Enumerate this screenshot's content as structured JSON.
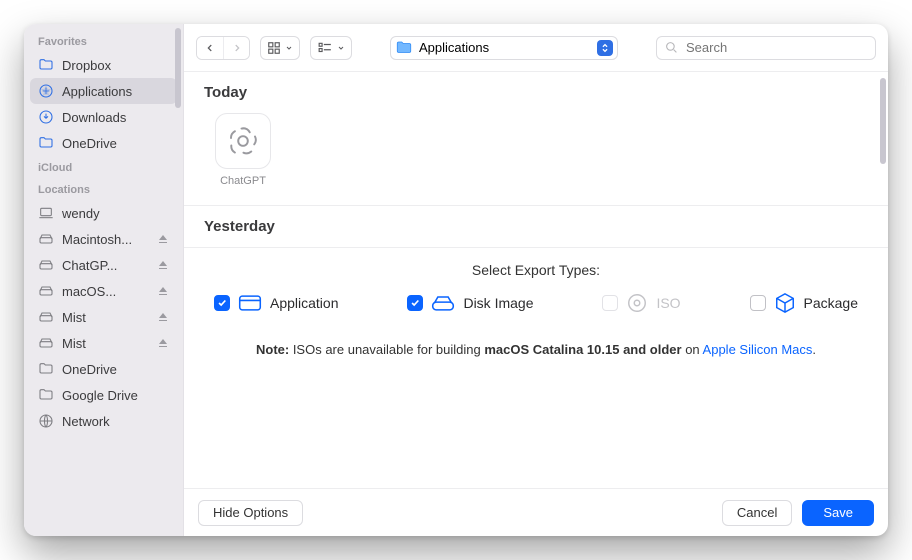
{
  "sidebar": {
    "sections": [
      {
        "label": "Favorites",
        "items": [
          {
            "label": "Dropbox",
            "icon": "folder"
          },
          {
            "label": "Applications",
            "icon": "apps",
            "active": true
          },
          {
            "label": "Downloads",
            "icon": "download"
          },
          {
            "label": "OneDrive",
            "icon": "folder"
          }
        ]
      },
      {
        "label": "iCloud",
        "items": []
      },
      {
        "label": "Locations",
        "items": [
          {
            "label": "wendy",
            "icon": "laptop"
          },
          {
            "label": "Macintosh...",
            "icon": "disk",
            "eject": true
          },
          {
            "label": "ChatGP...",
            "icon": "disk",
            "eject": true
          },
          {
            "label": "macOS...",
            "icon": "disk",
            "eject": true
          },
          {
            "label": "Mist",
            "icon": "disk",
            "eject": true
          },
          {
            "label": "Mist",
            "icon": "disk",
            "eject": true
          },
          {
            "label": "OneDrive",
            "icon": "folder-gray"
          },
          {
            "label": "Google Drive",
            "icon": "folder-gray"
          },
          {
            "label": "Network",
            "icon": "globe"
          }
        ]
      }
    ]
  },
  "toolbar": {
    "location": "Applications",
    "search_placeholder": "Search"
  },
  "content": {
    "today": {
      "label": "Today",
      "items": [
        {
          "name": "ChatGPT"
        }
      ]
    },
    "yesterday": {
      "label": "Yesterday"
    }
  },
  "export": {
    "title": "Select Export Types:",
    "options": [
      {
        "label": "Application",
        "checked": true
      },
      {
        "label": "Disk Image",
        "checked": true
      },
      {
        "label": "ISO",
        "checked": false,
        "disabled": true
      },
      {
        "label": "Package",
        "checked": false
      }
    ],
    "note_prefix": "Note:",
    "note_mid": " ISOs are unavailable for building ",
    "note_bold2": "macOS Catalina 10.15 and older",
    "note_mid2": " on ",
    "note_link": "Apple Silicon Macs",
    "note_suffix": "."
  },
  "footer": {
    "hide": "Hide Options",
    "cancel": "Cancel",
    "save": "Save"
  }
}
